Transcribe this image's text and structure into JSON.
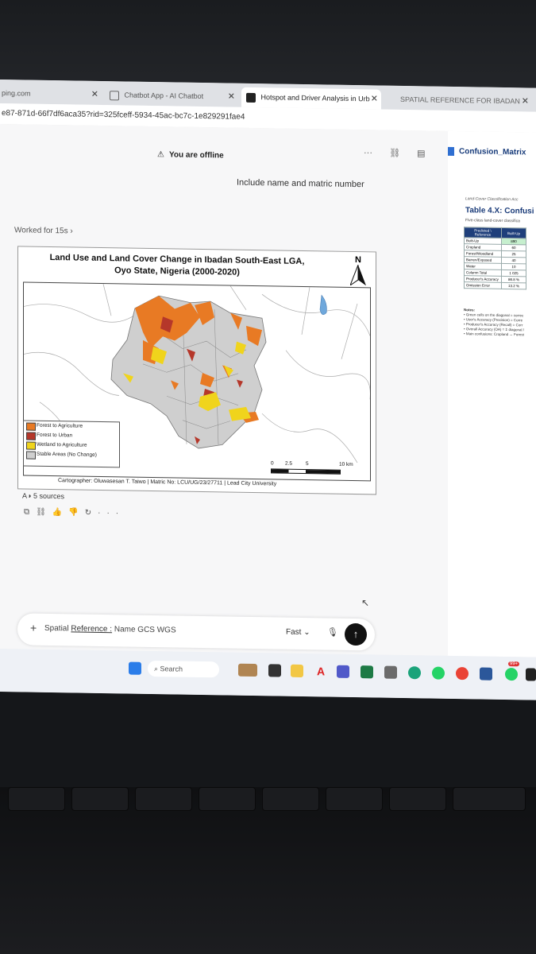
{
  "browser": {
    "tabs": [
      {
        "label": "ping.com",
        "active": false
      },
      {
        "label": "Chatbot App - AI Chatbot",
        "active": false
      },
      {
        "label": "Hotspot and Driver Analysis in Urb",
        "active": true
      },
      {
        "label": "SPATIAL REFERENCE FOR IBADAN",
        "active": false
      }
    ],
    "url": "e87-871d-66f7df6aca35?rid=325fceff-5934-45ac-bc7c-1e829291fae4"
  },
  "chat": {
    "offline_text": "You are offline",
    "user_prompt": "Include name and matric number",
    "worked_label": "Worked for 15s",
    "sources_label": "5 sources",
    "composer_text_prefix": "Spatial ",
    "composer_text_link": "Reference :",
    "composer_text_suffix": " Name GCS WGS",
    "mode_label": "Fast"
  },
  "map": {
    "title_line1": "Land Use and Land Cover Change in Ibadan South-East LGA,",
    "title_line2": "Oyo State, Nigeria (2000-2020)",
    "north_label": "N",
    "legend": [
      {
        "label": "Forest to Agriculture",
        "color": "#e87a24"
      },
      {
        "label": "Forest to Urban",
        "color": "#b5372a"
      },
      {
        "label": "Wetland to Agriculture",
        "color": "#f0d41c"
      },
      {
        "label": "Stable Areas (No Change)",
        "color": "#cfcfcf"
      }
    ],
    "scale_labels": [
      "0",
      "2.5",
      "5",
      "10 km"
    ],
    "credit": "Cartographer: Oluwasesan T. Taiwo | Matric No: LCU/UG/23/27711 | Lead City University"
  },
  "side_doc": {
    "title": "Confusion_Matrix",
    "small_heading": "Land-Cover Classification Acc",
    "table_title": "Table 4.X: Confusi",
    "subtitle": "Five-class land-cover classifica",
    "header": [
      "Predicted \\ Reference",
      "Built-Up"
    ],
    "rows": [
      [
        "Built-Up",
        "890"
      ],
      [
        "Cropland",
        "60"
      ],
      [
        "Forest/Woodland",
        "25"
      ],
      [
        "Barren/Exposed",
        "40"
      ],
      [
        "Water",
        "10"
      ],
      [
        "Column Total",
        "1 025"
      ],
      [
        "Producer's Accuracy",
        "86.8 %"
      ],
      [
        "Omission Error",
        "13.2 %"
      ]
    ],
    "notes": [
      "Notes:",
      "• Green cells on the diagonal = correc",
      "• User's Accuracy (Precision) = Corre",
      "• Producer's Accuracy (Recall) = Corr",
      "• Overall Accuracy (OA) = Σ diagonal /",
      "• Main confusions: Cropland ↔ Forest"
    ]
  },
  "taskbar": {
    "search_placeholder": "Search",
    "badge": "99+"
  }
}
